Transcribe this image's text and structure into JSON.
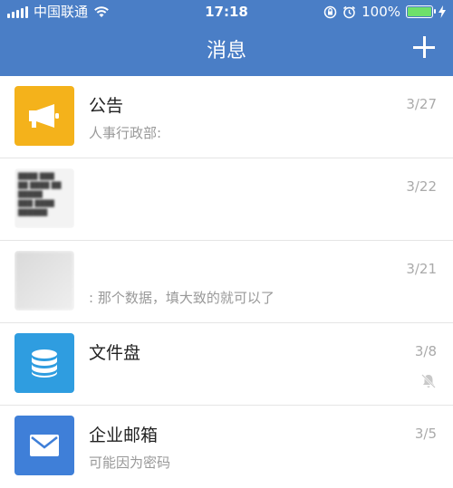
{
  "status": {
    "carrier": "中国联通",
    "time": "17:18",
    "battery": "100%"
  },
  "header": {
    "title": "消息",
    "add_label": "+"
  },
  "colors": {
    "header_bg": "#4a7ec6",
    "announcement": "#f4b21b",
    "drive": "#2f9de0",
    "mail": "#3f7fd8"
  },
  "conversations": [
    {
      "title": "公告",
      "preview": "人事行政部: ",
      "date": "3/27",
      "icon": "megaphone-icon"
    },
    {
      "title": "",
      "preview": "",
      "date": "3/22",
      "icon": "document-thumbnail"
    },
    {
      "title": "",
      "preview": ": 那个数据，填大致的就可以了",
      "date": "3/21",
      "icon": "group-thumbnail"
    },
    {
      "title": "文件盘",
      "preview": "",
      "date": "3/8",
      "icon": "database-icon",
      "muted": true
    },
    {
      "title": "企业邮箱",
      "preview": "可能因为密码",
      "date": "3/5",
      "icon": "mail-icon"
    }
  ]
}
